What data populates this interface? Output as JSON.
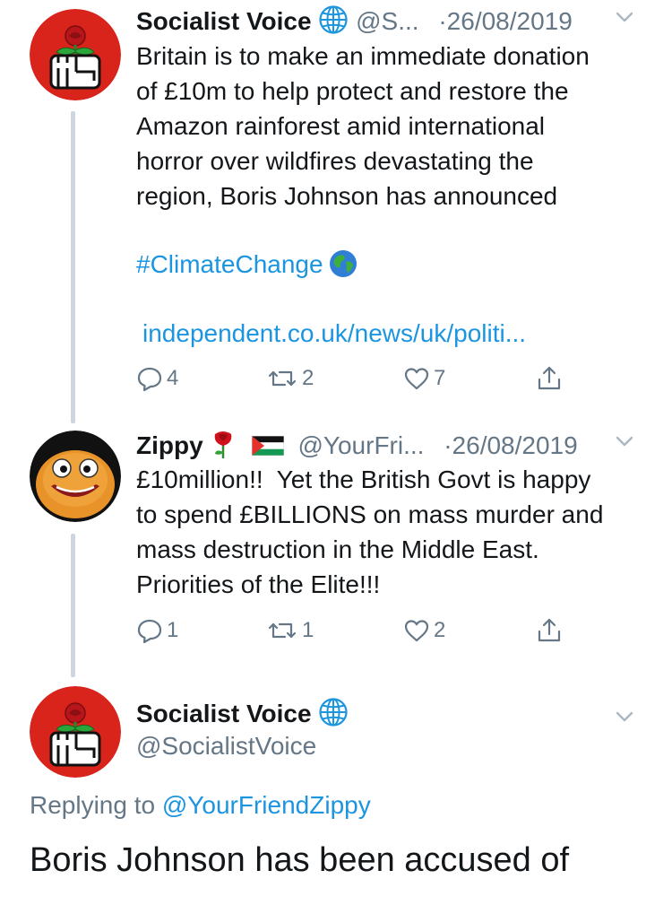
{
  "tweets": [
    {
      "name": "Socialist Voice",
      "handle": "@S...",
      "separator": "·",
      "date": "26/08/2019",
      "text_lines": [
        "Britain is to make an immediate donation",
        "of £10m to help protect and restore the",
        "Amazon rainforest amid international",
        "horror over wildfires devastating the",
        "region, Boris Johnson has announced"
      ],
      "hashtag": "#ClimateChange",
      "link": "independent.co.uk/news/uk/politi...",
      "replies": "4",
      "retweets": "2",
      "likes": "7"
    },
    {
      "name": "Zippy",
      "handle": "@YourFri...",
      "separator": "·",
      "date": "26/08/2019",
      "text_lines": [
        "£10million!!  Yet the British Govt is happy",
        "to spend £BILLIONS on mass murder and",
        "mass destruction in the Middle East.",
        "Priorities of the Elite!!!"
      ],
      "replies": "1",
      "retweets": "1",
      "likes": "2"
    }
  ],
  "main_tweet": {
    "name": "Socialist Voice",
    "handle": "@SocialistVoice",
    "replying_prefix": "Replying to ",
    "replying_handle": "@YourFriendZippy",
    "text": "Boris Johnson has been accused of"
  },
  "colors": {
    "link": "#1b95e0",
    "secondary": "#657786",
    "avatar_red": "#d9241c",
    "thread_line": "#cdd5de"
  },
  "icons": [
    "globe-icon",
    "earth-emoji-icon",
    "rose-emoji-icon",
    "palestine-flag-icon",
    "reply-icon",
    "retweet-icon",
    "like-icon",
    "share-icon",
    "chevron-down-icon"
  ]
}
